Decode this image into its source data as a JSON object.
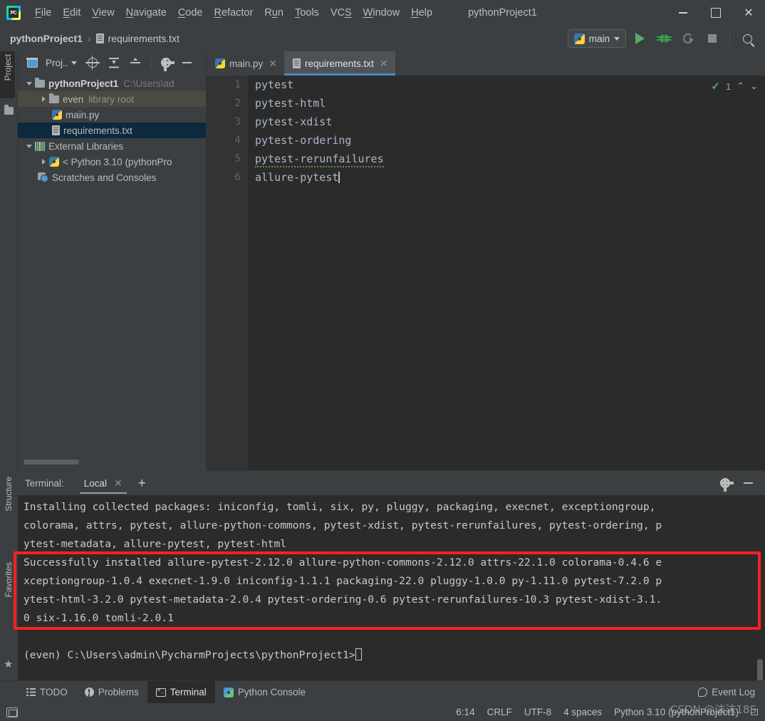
{
  "window": {
    "title": "pythonProject1",
    "app_icon": "pycharm-logo-icon",
    "minimize_label": "−",
    "maximize_label": "□",
    "close_label": "✕"
  },
  "menubar": {
    "items": [
      {
        "label": "File",
        "mnemonic": "F"
      },
      {
        "label": "Edit",
        "mnemonic": "E"
      },
      {
        "label": "View",
        "mnemonic": "V"
      },
      {
        "label": "Navigate",
        "mnemonic": "N"
      },
      {
        "label": "Code",
        "mnemonic": "C"
      },
      {
        "label": "Refactor",
        "mnemonic": "R"
      },
      {
        "label": "Run",
        "mnemonic": "u"
      },
      {
        "label": "Tools",
        "mnemonic": "T"
      },
      {
        "label": "VCS",
        "mnemonic": "S"
      },
      {
        "label": "Window",
        "mnemonic": "W"
      },
      {
        "label": "Help",
        "mnemonic": "H"
      }
    ]
  },
  "navbar": {
    "breadcrumb_root": "pythonProject1",
    "breadcrumb_separator": "›",
    "breadcrumb_file": "requirements.txt",
    "run_config": "main",
    "run_config_icon": "python-icon",
    "buttons": [
      "run-icon",
      "debug-icon",
      "coverage-icon",
      "stop-icon",
      "search-icon"
    ]
  },
  "left_strip": {
    "project_tab": "Project",
    "structure_tab": "Structure",
    "favorites_tab": "Favorites"
  },
  "project_panel": {
    "toolbar_label": "Proj..",
    "toolbar_icons": [
      "select-opened-file-icon",
      "scroll-from-source-icon",
      "collapse-all-icon",
      "expand-selection-icon",
      "settings-gear-icon",
      "hide-panel-icon"
    ],
    "tree": [
      {
        "label": "pythonProject1",
        "suffix": "C:\\Users\\ad",
        "icon": "folder-icon",
        "arrow": "down",
        "indent": 0,
        "state": "normal",
        "bold": true
      },
      {
        "label": "even",
        "suffix": "library root",
        "icon": "folder-icon",
        "arrow": "right",
        "indent": 1,
        "state": "highlight",
        "bold": false
      },
      {
        "label": "main.py",
        "suffix": "",
        "icon": "python-file-icon",
        "arrow": "none",
        "indent": 2,
        "state": "normal",
        "bold": false
      },
      {
        "label": "requirements.txt",
        "suffix": "",
        "icon": "text-file-icon",
        "arrow": "none",
        "indent": 2,
        "state": "selected",
        "bold": false
      },
      {
        "label": "External Libraries",
        "suffix": "",
        "icon": "library-icon",
        "arrow": "down",
        "indent": 0,
        "state": "normal",
        "bold": false
      },
      {
        "label": "< Python 3.10 (pythonPro",
        "suffix": "",
        "icon": "python-icon",
        "arrow": "right",
        "indent": 1,
        "state": "normal",
        "bold": false
      },
      {
        "label": "Scratches and Consoles",
        "suffix": "",
        "icon": "scratches-icon",
        "arrow": "none",
        "indent": 1,
        "state": "normal",
        "bold": false
      }
    ]
  },
  "editor": {
    "tabs": [
      {
        "label": "main.py",
        "icon": "python-file-icon",
        "active": false,
        "close": "✕"
      },
      {
        "label": "requirements.txt",
        "icon": "text-file-icon",
        "active": true,
        "close": "✕"
      }
    ],
    "line_numbers": [
      "1",
      "2",
      "3",
      "4",
      "5",
      "6"
    ],
    "lines": [
      {
        "text": "pytest",
        "squiggle": false
      },
      {
        "text": "pytest-html",
        "squiggle": false
      },
      {
        "text": "pytest-xdist",
        "squiggle": false
      },
      {
        "text": "pytest-ordering",
        "squiggle": false
      },
      {
        "text": "pytest-rerunfailures",
        "squiggle": true
      },
      {
        "text": "allure-pytest",
        "squiggle": false,
        "caret": true
      }
    ],
    "inspection": {
      "icon": "inspection-ok-icon",
      "count": "1",
      "prev": "⌃",
      "next": "⌄"
    }
  },
  "terminal": {
    "title": "Terminal:",
    "tab_label": "Local",
    "tab_close": "✕",
    "add_label": "+",
    "settings_icon": "settings-gear-icon",
    "hide_icon": "hide-panel-icon",
    "lines": [
      "Installing collected packages: iniconfig, tomli, six, py, pluggy, packaging, execnet, exceptiongroup,",
      "colorama, attrs, pytest, allure-python-commons, pytest-xdist, pytest-rerunfailures, pytest-ordering, p",
      "ytest-metadata, allure-pytest, pytest-html"
    ],
    "highlighted_lines": [
      "Successfully installed allure-pytest-2.12.0 allure-python-commons-2.12.0 attrs-22.1.0 colorama-0.4.6 e",
      "xceptiongroup-1.0.4 execnet-1.9.0 iniconfig-1.1.1 packaging-22.0 pluggy-1.0.0 py-1.11.0 pytest-7.2.0 p",
      "ytest-html-3.2.0 pytest-metadata-2.0.4 pytest-ordering-0.6 pytest-rerunfailures-10.3 pytest-xdist-3.1.",
      "0 six-1.16.0 tomli-2.0.1"
    ],
    "prompt": "(even) C:\\Users\\admin\\PycharmProjects\\pythonProject1>",
    "highlight_color": "#fa2020"
  },
  "bottom_bar": {
    "items": [
      {
        "label": "TODO",
        "icon": "todo-icon",
        "active": false
      },
      {
        "label": "Problems",
        "icon": "problems-icon",
        "active": false
      },
      {
        "label": "Terminal",
        "icon": "terminal-icon",
        "active": true
      },
      {
        "label": "Python Console",
        "icon": "python-console-icon",
        "active": false
      }
    ],
    "event_log": "Event Log",
    "event_log_icon": "event-log-icon"
  },
  "status_bar": {
    "caret_position": "6:14",
    "line_separator": "CRLF",
    "encoding": "UTF-8",
    "indent": "4 spaces",
    "interpreter": "Python 3.10 (pythonProject1)",
    "lock_icon": "read-only-lock-icon"
  },
  "watermark": "CSDN @沫沫18S",
  "colors": {
    "chrome": "#3c3f41",
    "editor_bg": "#2b2b2b",
    "accent_blue": "#4a88c7",
    "selection": "#0d293e",
    "highlight_red": "#fa2020",
    "green": "#59a869"
  }
}
